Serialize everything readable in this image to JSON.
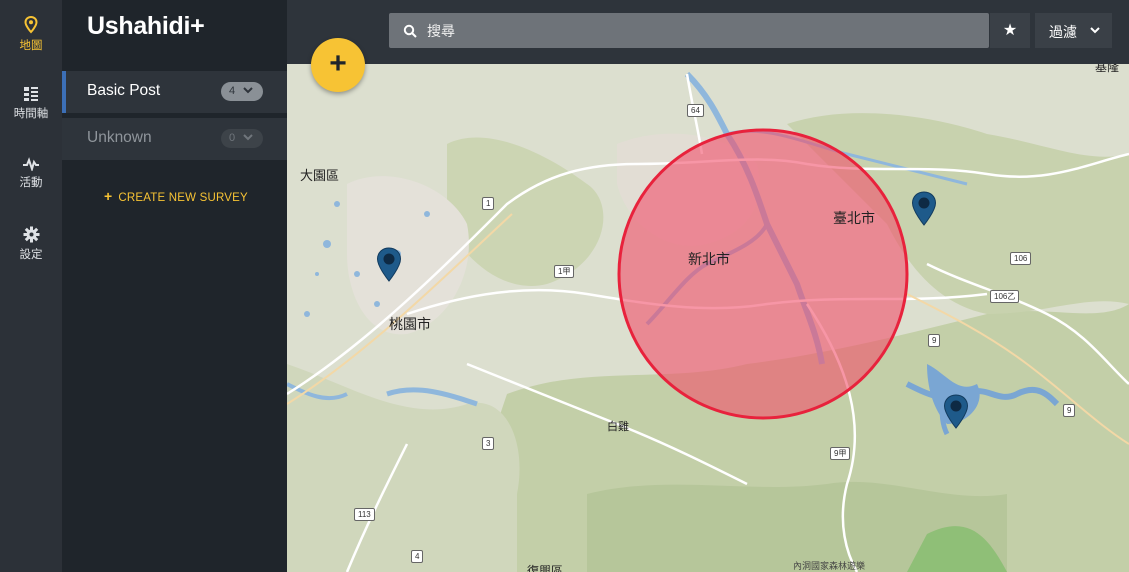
{
  "rail": [
    {
      "label": "地圖",
      "icon": "map-pin-icon",
      "active": true
    },
    {
      "label": "時間軸",
      "icon": "timeline-icon",
      "active": false
    },
    {
      "label": "活動",
      "icon": "activity-icon",
      "active": false
    },
    {
      "label": "設定",
      "icon": "gear-icon",
      "active": false
    }
  ],
  "brand": "Ushahidi+",
  "surveys": [
    {
      "label": "Basic Post",
      "count": "4"
    },
    {
      "label": "Unknown",
      "count": "0"
    }
  ],
  "create_survey": "CREATE NEW SURVEY",
  "search": {
    "placeholder": "搜尋",
    "value": ""
  },
  "toolbar": {
    "star": "★",
    "filter_label": "過濾",
    "add": "+"
  },
  "colors": {
    "accent": "#f7c334",
    "active_border": "#3c6fb6",
    "area_fill": "#f2506a",
    "pin": "#1e5a8a"
  },
  "map": {
    "places": [
      "大園區",
      "桃園市",
      "新北市",
      "臺北市",
      "白雞",
      "基隆",
      "復興區",
      "內洞國家森林遊樂"
    ],
    "routes": [
      "64",
      "1",
      "1甲",
      "106",
      "106乙",
      "9",
      "9",
      "9甲",
      "3",
      "113",
      "4"
    ],
    "markers": 3
  }
}
